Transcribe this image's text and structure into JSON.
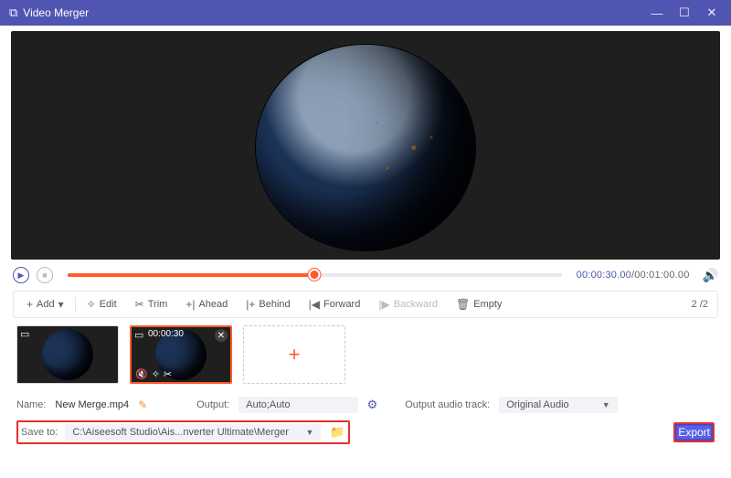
{
  "titlebar": {
    "title": "Video Merger"
  },
  "playback": {
    "current_time": "00:00:30.00",
    "total_time": "00:01:00.00",
    "progress_pct": 50
  },
  "toolbar": {
    "add": "Add",
    "edit": "Edit",
    "trim": "Trim",
    "ahead": "Ahead",
    "behind": "Behind",
    "forward": "Forward",
    "backward": "Backward",
    "empty": "Empty",
    "counter": "2 /2"
  },
  "thumbs": {
    "clip2_duration": "00:00:30"
  },
  "options": {
    "name_label": "Name:",
    "name_value": "New Merge.mp4",
    "output_label": "Output:",
    "output_value": "Auto;Auto",
    "audio_track_label": "Output audio track:",
    "audio_track_value": "Original Audio",
    "saveto_label": "Save to:",
    "saveto_value": "C:\\Aiseesoft Studio\\Ais...nverter Ultimate\\Merger",
    "export": "Export"
  }
}
